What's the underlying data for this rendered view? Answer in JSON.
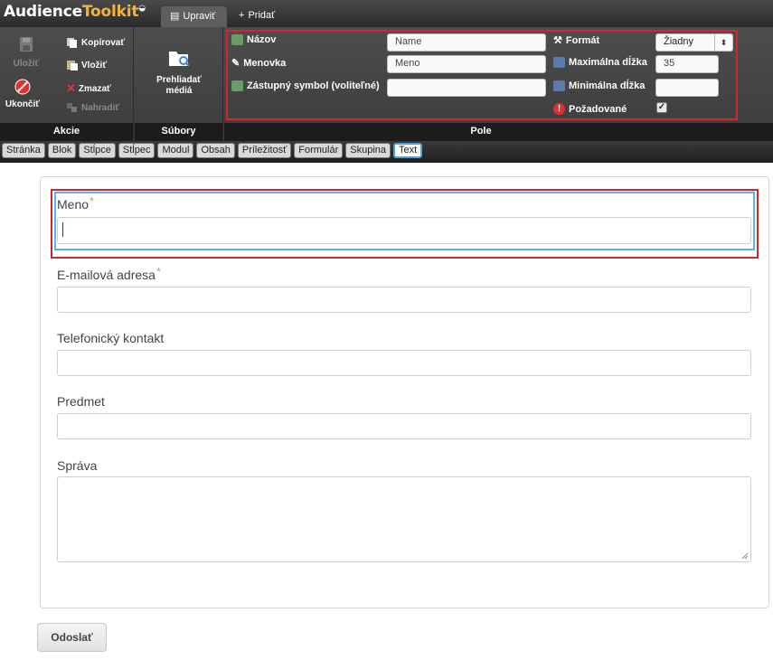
{
  "app": {
    "logo_part1": "Audience",
    "logo_part2": "Toolkit",
    "tabs": {
      "edit": "Upraviť",
      "add": "Pridať"
    }
  },
  "ribbon": {
    "akcie": {
      "title": "Akcie",
      "save": "Uložiť",
      "copy": "Kopírovať",
      "paste": "Vložiť",
      "delete": "Zmazať",
      "replace": "Nahradiť",
      "exit": "Ukončiť"
    },
    "subory": {
      "title": "Súbory",
      "browse": "Prehliadať médiá"
    },
    "pole": {
      "title": "Pole",
      "name_label": "Názov",
      "name_value": "Name",
      "tag_label": "Menovka",
      "tag_value": "Meno",
      "placeholder_label": "Zástupný symbol (voliteľné)",
      "placeholder_value": "",
      "format_label": "Formát",
      "format_value": "Žiadny",
      "maxlen_label": "Maximálna dĺžka",
      "maxlen_value": "35",
      "minlen_label": "Minimálna dĺžka",
      "minlen_value": "",
      "required_label": "Požadované",
      "required_checked": "✓"
    }
  },
  "element_tabs": [
    "Stránka",
    "Blok",
    "Stĺpce",
    "Stĺpec",
    "Modul",
    "Obsah",
    "Príležitosť",
    "Formulár",
    "Skupina",
    "Text"
  ],
  "active_tab": "Text",
  "form": {
    "fields": {
      "name": {
        "label": "Meno",
        "required": "*",
        "value": ""
      },
      "email": {
        "label": "E-mailová adresa",
        "required": "*",
        "value": ""
      },
      "phone": {
        "label": "Telefonický kontakt",
        "value": ""
      },
      "subject": {
        "label": "Predmet",
        "value": ""
      },
      "message": {
        "label": "Správa",
        "value": ""
      }
    },
    "submit": "Odoslať"
  },
  "colors": {
    "highlight_red": "#d0262c",
    "focus_blue": "#5bb4e5",
    "logo_accent": "#f3b33d",
    "required_star": "#d99a3a"
  }
}
